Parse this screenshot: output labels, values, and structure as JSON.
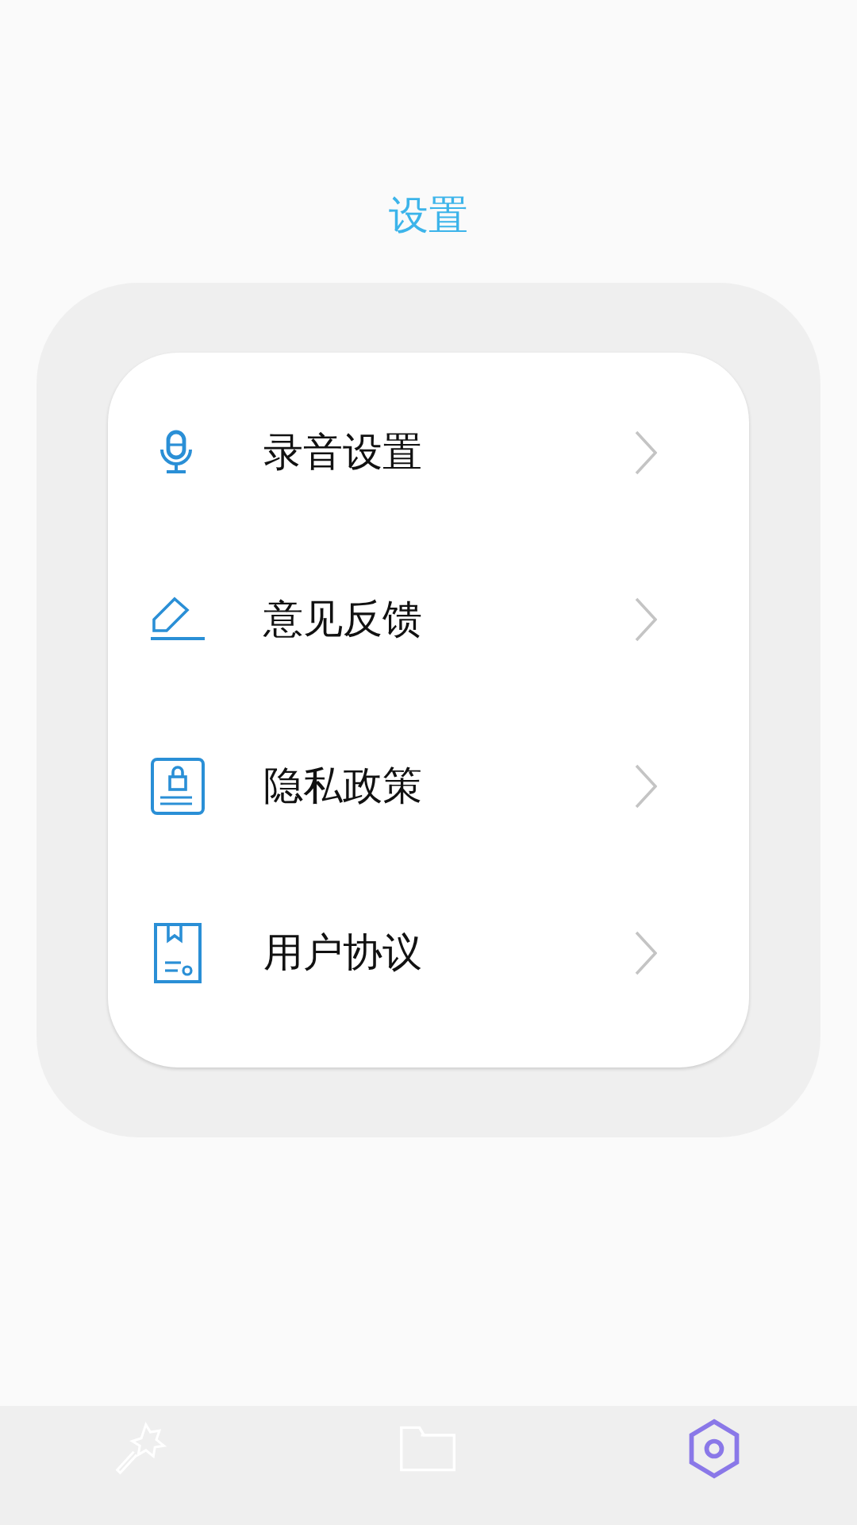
{
  "title": "设置",
  "menu": [
    {
      "kind": "mic",
      "label": "录音设置"
    },
    {
      "kind": "pen",
      "label": "意见反馈"
    },
    {
      "kind": "privacy",
      "label": "隐私政策"
    },
    {
      "kind": "agreement",
      "label": "用户协议"
    }
  ],
  "tabs": [
    {
      "kind": "magic",
      "selected": false
    },
    {
      "kind": "folder",
      "selected": false
    },
    {
      "kind": "settings",
      "selected": true
    }
  ]
}
